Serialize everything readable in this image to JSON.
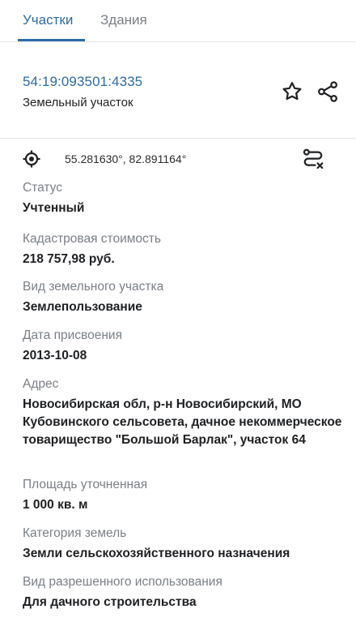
{
  "tabs": [
    {
      "label": "Участки",
      "active": true
    },
    {
      "label": "Здания",
      "active": false
    }
  ],
  "parcel": {
    "cadastral_number": "54:19:093501:4335",
    "object_type": "Земельный участок"
  },
  "coordinates": {
    "text": "55.281630°, 82.891164°"
  },
  "icons": {
    "star": "star-icon",
    "share": "share-icon",
    "target": "location-target-icon",
    "route": "route-icon"
  },
  "colors": {
    "accent": "#2f6aa5",
    "label": "#7a7f85",
    "value": "#1e2023"
  },
  "fields": [
    {
      "label": "Статус",
      "value": "Учтенный"
    },
    {
      "label": "Кадастровая стоимость",
      "value": "218 757,98 руб."
    },
    {
      "label": "Вид земельного участка",
      "value": "Землепользование"
    },
    {
      "label": "Дата присвоения",
      "value": "2013-10-08"
    },
    {
      "label": "Адрес",
      "value": "Новосибирская обл, р-н Новосибирский, МО Кубовинского сельсовета, дачное некоммерческое товарищество \"Большой Барлак\", участок 64"
    },
    {
      "label": "Площадь уточненная",
      "value": "1 000 кв. м"
    },
    {
      "label": "Категория земель",
      "value": "Земли сельскохозяйственного назначения"
    },
    {
      "label": "Вид разрешенного использования",
      "value": "Для дачного строительства"
    }
  ]
}
